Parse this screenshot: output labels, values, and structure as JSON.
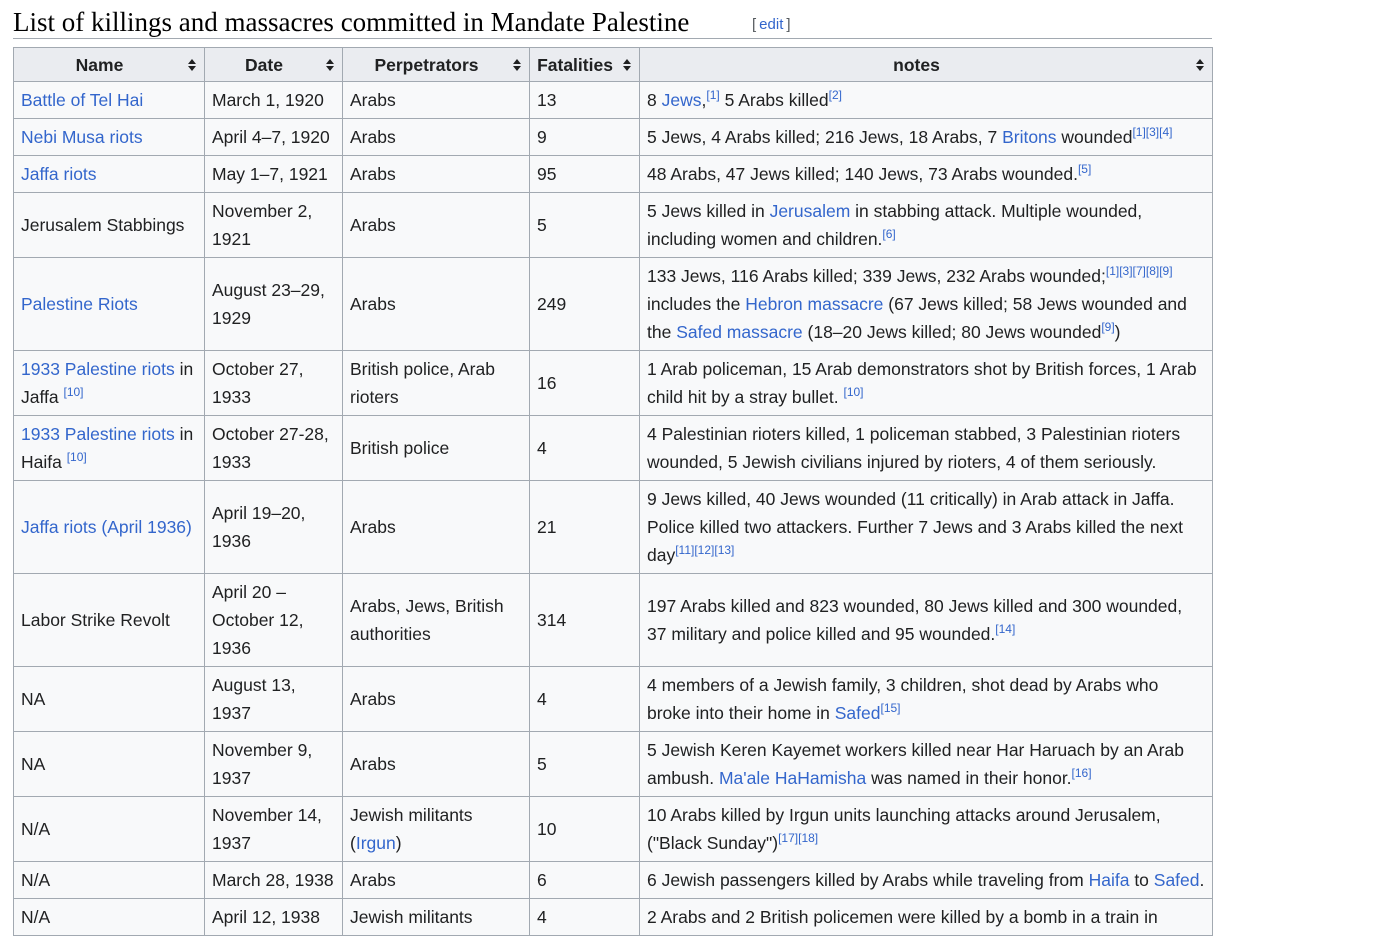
{
  "section": {
    "title": "List of killings and massacres committed in Mandate Palestine",
    "edit_open": "[",
    "edit_label": "edit",
    "edit_close": "]"
  },
  "table": {
    "headers": [
      "Name",
      "Date",
      "Perpetrators",
      "Fatalities",
      "notes"
    ],
    "rows": [
      {
        "name": [
          {
            "t": "Battle of Tel Hai",
            "link": true
          }
        ],
        "date": "March 1, 1920",
        "perp": [
          {
            "t": "Arabs"
          }
        ],
        "fat": "13",
        "notes": [
          {
            "t": "8 "
          },
          {
            "t": "Jews",
            "link": true
          },
          {
            "t": ","
          },
          {
            "t": "[1]",
            "sup": true
          },
          {
            "t": " 5 Arabs killed"
          },
          {
            "t": "[2]",
            "sup": true
          }
        ]
      },
      {
        "name": [
          {
            "t": "Nebi Musa riots",
            "link": true
          }
        ],
        "date": "April 4–7, 1920",
        "perp": [
          {
            "t": "Arabs"
          }
        ],
        "fat": "9",
        "notes": [
          {
            "t": "5 Jews, 4 Arabs killed; 216 Jews, 18 Arabs, 7 "
          },
          {
            "t": "Britons",
            "link": true
          },
          {
            "t": " wounded"
          },
          {
            "t": "[1][3][4]",
            "sup": true
          }
        ]
      },
      {
        "name": [
          {
            "t": "Jaffa riots",
            "link": true
          }
        ],
        "date": "May 1–7, 1921",
        "perp": [
          {
            "t": "Arabs"
          }
        ],
        "fat": "95",
        "notes": [
          {
            "t": "48 Arabs, 47 Jews killed; 140 Jews, 73 Arabs wounded."
          },
          {
            "t": "[5]",
            "sup": true
          }
        ]
      },
      {
        "name": [
          {
            "t": "Jerusalem Stabbings"
          }
        ],
        "date": "November 2, 1921",
        "perp": [
          {
            "t": "Arabs"
          }
        ],
        "fat": "5",
        "notes": [
          {
            "t": "5 Jews killed in "
          },
          {
            "t": "Jerusalem",
            "link": true
          },
          {
            "t": " in stabbing attack. Multiple wounded, including women and children."
          },
          {
            "t": "[6]",
            "sup": true
          }
        ]
      },
      {
        "name": [
          {
            "t": "Palestine Riots",
            "link": true
          }
        ],
        "date": "August 23–29, 1929",
        "perp": [
          {
            "t": "Arabs"
          }
        ],
        "fat": "249",
        "notes": [
          {
            "t": "133 Jews, 116 Arabs killed; 339 Jews, 232 Arabs wounded;"
          },
          {
            "t": "[1][3][7][8][9]",
            "sup": true
          },
          {
            "t": " includes the "
          },
          {
            "t": "Hebron massacre",
            "link": true
          },
          {
            "t": " (67 Jews killed; 58 Jews wounded and the "
          },
          {
            "t": "Safed massacre",
            "link": true
          },
          {
            "t": " (18–20 Jews killed; 80 Jews wounded"
          },
          {
            "t": "[9]",
            "sup": true
          },
          {
            "t": ")"
          }
        ]
      },
      {
        "name": [
          {
            "t": "1933 Palestine riots",
            "link": true
          },
          {
            "t": " in Jaffa "
          },
          {
            "t": "[10]",
            "sup": true
          }
        ],
        "date": "October 27, 1933",
        "perp": [
          {
            "t": "British police, Arab rioters"
          }
        ],
        "fat": "16",
        "notes": [
          {
            "t": "1 Arab policeman, 15 Arab demonstrators shot by British forces, 1 Arab child hit by a stray bullet. "
          },
          {
            "t": "[10]",
            "sup": true
          }
        ]
      },
      {
        "name": [
          {
            "t": "1933 Palestine riots",
            "link": true
          },
          {
            "t": " in Haifa "
          },
          {
            "t": "[10]",
            "sup": true
          }
        ],
        "date": "October 27-28, 1933",
        "perp": [
          {
            "t": "British police"
          }
        ],
        "fat": "4",
        "notes": [
          {
            "t": "4 Palestinian rioters killed, 1 policeman stabbed, 3 Palestinian rioters wounded, 5 Jewish civilians injured by rioters, 4 of them seriously."
          }
        ]
      },
      {
        "name": [
          {
            "t": "Jaffa riots (April 1936)",
            "link": true
          }
        ],
        "date": "April 19–20, 1936",
        "perp": [
          {
            "t": "Arabs"
          }
        ],
        "fat": "21",
        "notes": [
          {
            "t": "9 Jews killed, 40 Jews wounded (11 critically) in Arab attack in Jaffa. Police killed two attackers. Further 7 Jews and 3 Arabs killed the next day"
          },
          {
            "t": "[11][12][13]",
            "sup": true
          }
        ]
      },
      {
        "name": [
          {
            "t": "Labor Strike Revolt"
          }
        ],
        "date": "April 20 – October 12, 1936",
        "perp": [
          {
            "t": "Arabs, Jews, British authorities"
          }
        ],
        "fat": "314",
        "notes": [
          {
            "t": "197 Arabs killed and 823 wounded, 80 Jews killed and 300 wounded, 37 military and police killed and 95 wounded."
          },
          {
            "t": "[14]",
            "sup": true
          }
        ]
      },
      {
        "name": [
          {
            "t": "NA"
          }
        ],
        "date": "August 13, 1937",
        "perp": [
          {
            "t": "Arabs"
          }
        ],
        "fat": "4",
        "notes": [
          {
            "t": "4 members of a Jewish family, 3 children, shot dead by Arabs who broke into their home in "
          },
          {
            "t": "Safed",
            "link": true
          },
          {
            "t": "[15]",
            "sup": true
          }
        ]
      },
      {
        "name": [
          {
            "t": "NA"
          }
        ],
        "date": "November 9, 1937",
        "perp": [
          {
            "t": "Arabs"
          }
        ],
        "fat": "5",
        "notes": [
          {
            "t": "5 Jewish Keren Kayemet workers killed near Har Haruach by an Arab ambush. "
          },
          {
            "t": "Ma'ale HaHamisha",
            "link": true
          },
          {
            "t": " was named in their honor."
          },
          {
            "t": "[16]",
            "sup": true
          }
        ]
      },
      {
        "name": [
          {
            "t": "N/A"
          }
        ],
        "date": "November 14, 1937",
        "perp": [
          {
            "t": "Jewish militants ("
          },
          {
            "t": "Irgun",
            "link": true
          },
          {
            "t": ")"
          }
        ],
        "fat": "10",
        "notes": [
          {
            "t": "10 Arabs killed by Irgun units launching attacks around Jerusalem, (\"Black Sunday\")"
          },
          {
            "t": "[17][18]",
            "sup": true
          }
        ]
      },
      {
        "name": [
          {
            "t": "N/A"
          }
        ],
        "date": "March 28, 1938",
        "perp": [
          {
            "t": "Arabs"
          }
        ],
        "fat": "6",
        "notes": [
          {
            "t": "6 Jewish passengers killed by Arabs while traveling from "
          },
          {
            "t": "Haifa",
            "link": true
          },
          {
            "t": " to "
          },
          {
            "t": "Safed",
            "link": true
          },
          {
            "t": "."
          }
        ]
      },
      {
        "name": [
          {
            "t": "N/A"
          }
        ],
        "date": "April 12, 1938",
        "perp": [
          {
            "t": "Jewish militants"
          }
        ],
        "fat": "4",
        "notes": [
          {
            "t": "2 Arabs and 2 British policemen were killed by a bomb in a train in"
          }
        ]
      }
    ]
  }
}
